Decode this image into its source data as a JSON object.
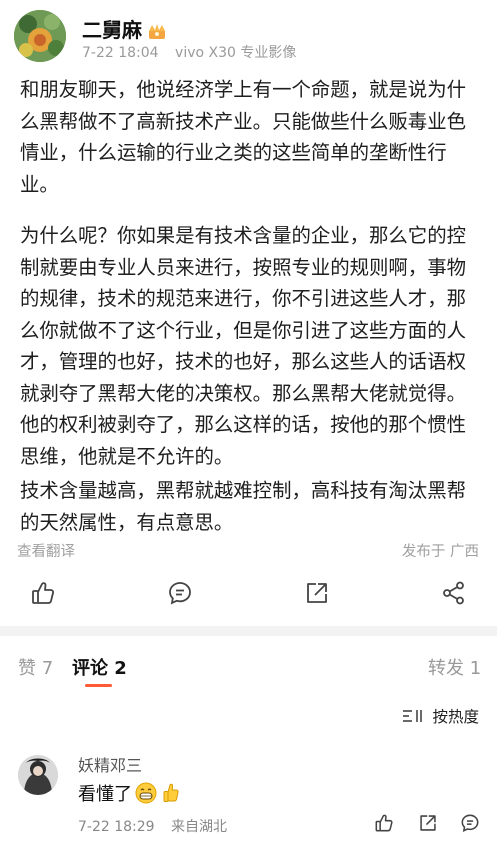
{
  "post": {
    "author": "二舅麻",
    "time": "7-22 18:04",
    "device": "vivo X30 专业影像",
    "paragraphs": [
      "和朋友聊天，他说经济学上有一个命题，就是说为什么黑帮做不了高新技术产业。只能做些什么贩毒业色情业，什么运输的行业之类的这些简单的垄断性行业。",
      "为什么呢？你如果是有技术含量的企业，那么它的控制就要由专业人员来进行，按照专业的规则啊，事物的规律，技术的规范来进行，你不引进这些人才，那么你就做不了这个行业，但是你引进了这些方面的人才，管理的也好，技术的也好，那么这些人的话语权就剥夺了黑帮大佬的决策权。那么黑帮大佬就觉得。他的权利被剥夺了，那么这样的话，按他的那个惯性思维，他就是不允许的。",
      "技术含量越高，黑帮就越难控制，高科技有淘汰黑帮的天然属性，有点意思。"
    ],
    "translate_label": "查看翻译",
    "location": "发布于 广西"
  },
  "tabs": {
    "likes": "赞 7",
    "comments": "评论 2",
    "reposts": "转发 1"
  },
  "sort_label": "按热度",
  "comment": {
    "name": "妖精邓三",
    "text": "看懂了",
    "time": "7-22 18:29",
    "location": "来自湖北"
  },
  "icons": {
    "like": "thumbs-up-icon",
    "comment": "comment-icon",
    "share": "share-icon",
    "more": "network-share-icon",
    "sort": "sort-icon"
  },
  "colors": {
    "accent": "#ff5a36",
    "muted": "#9a9a9a"
  }
}
